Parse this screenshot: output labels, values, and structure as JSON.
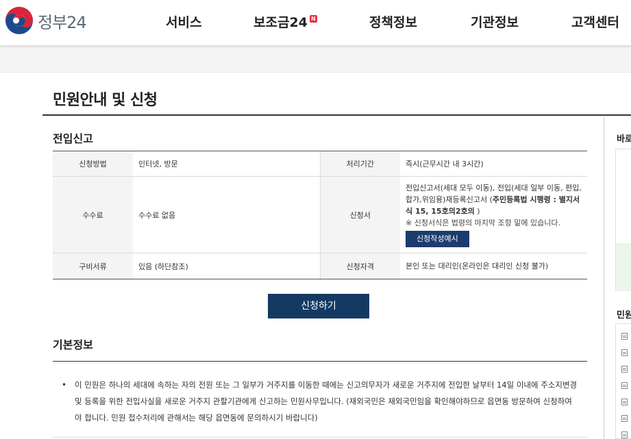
{
  "header": {
    "logo_text": "정부24",
    "nav": [
      {
        "label": "서비스"
      },
      {
        "label": "보조금24",
        "badge": "N"
      },
      {
        "label": "정책정보"
      },
      {
        "label": "기관정보"
      },
      {
        "label": "고객센터"
      }
    ]
  },
  "page": {
    "title": "민원안내 및 신청",
    "section": "전입신고"
  },
  "table": {
    "method_label": "신청방법",
    "method_value": "인터넷, 방문",
    "period_label": "처리기간",
    "period_value": "즉시(근무시간 내 3시간)",
    "fee_label": "수수료",
    "fee_value": "수수료 없음",
    "form_label": "신청서",
    "form_value_1": "전입신고서(세대 모두 이동), 전입(세대 일부 이동, 편입,합가,위임용)재등록신고서 (",
    "form_value_bold": "주민등록법 시행령 : 별지서식 15, 15호의2호의",
    "form_value_2": " )",
    "form_note": "※ 신청서식은 법령의 마지막 조항 밑에 있습니다.",
    "form_button": "신청작성예시",
    "docs_label": "구비서류",
    "docs_value": "있음 (하단참조)",
    "qual_label": "신청자격",
    "qual_value": "본인 또는 대리인(온라인은 대리인 신청 불가)"
  },
  "apply_button": "신청하기",
  "basic": {
    "title": "기본정보",
    "text": "이 민원은 하나의 세대에 속하는 자의 전원 또는 그 일부가 거주지를 이동한 때에는 신고의무자가 새로운 거주지에 전입한 날부터 14일 이내에 주소지변경 및 등록을 위한 전입사실을 새로운 거주지 관할기관에게 신고하는 민원사무입니다. (재외국민은 재외국민임을 확인해야하므로 읍면동 방문하여 신청하여야 합니다. 민원 접수처리에 관해서는 해당 읍면동에 문의하시기 바랍니다)"
  },
  "side": {
    "title1": "바로",
    "title2": "민원"
  },
  "colors": {
    "brand_navy": "#143a64",
    "badge_red": "#e8313d"
  }
}
